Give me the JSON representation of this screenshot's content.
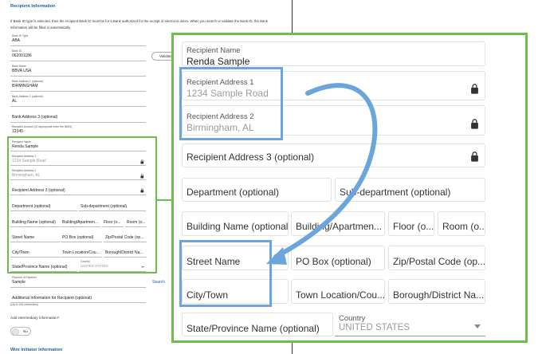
{
  "section_title": "Recipient Information",
  "note": "If Bank ID type is selected, then the recipient Bank ID must be for a Bank authorized for the receipt of electronic wires. When you search or validate the Bank ID, the Bank information will be filled in automatically.",
  "form": {
    "bank_id_type": {
      "label": "Bank ID Type",
      "value": "ABA"
    },
    "bank_id": {
      "label": "Bank ID",
      "value": "062001186"
    },
    "validate_label": "Validate",
    "bank_name": {
      "label": "Bank Name",
      "value": "BBVA USA"
    },
    "bank_address_1": {
      "label": "Bank Address 1 (optional)",
      "value": "BIRMINGHAM"
    },
    "bank_address_2": {
      "label": "Bank Address 2 (optional)",
      "value": "AL"
    },
    "bank_address_3": {
      "placeholder": "Bank Address 3 (optional)"
    },
    "recipient_account": {
      "label": "Recipient Account (ID appropriate enter the IBAN)",
      "value": "12345"
    },
    "recipient_name": {
      "label": "Recipient Name",
      "value": "Renda Sample"
    },
    "recipient_address_1": {
      "label": "Recipient Address 1",
      "value": "1234 Sample Road"
    },
    "recipient_address_2": {
      "label": "Recipient Address 2",
      "value": "Birmingham, AL"
    },
    "recipient_address_3": {
      "placeholder": "Recipient Address 3 (optional)"
    },
    "department": {
      "placeholder": "Department (optional)"
    },
    "sub_department": {
      "placeholder": "Sub-department (optional)"
    },
    "building_name": {
      "placeholder": "Building Name (optional)"
    },
    "building_number": {
      "placeholder": "Building/Apartmen...",
      "zoom_placeholder": "Building/Apartmen..."
    },
    "floor": {
      "placeholder": "Floor (o...",
      "zoom_placeholder": "Floor (o..."
    },
    "room": {
      "placeholder": "Room (o...",
      "zoom_placeholder": "Room (o..."
    },
    "street_name": {
      "placeholder": "Street Name"
    },
    "po_box": {
      "placeholder": "PO Box (optional)"
    },
    "zip": {
      "placeholder": "Zip/Postal Code (op..."
    },
    "city": {
      "placeholder": "City/Town"
    },
    "town_location": {
      "placeholder": "Town Location/Cou...",
      "zoom_placeholder": "Town Location/Cou..."
    },
    "borough": {
      "placeholder": "Borough/District Na..."
    },
    "state": {
      "placeholder": "State/Province Name (optional)"
    },
    "country": {
      "label": "Country",
      "value": "UNITED STATES"
    },
    "purpose": {
      "label": "Purpose of Payment",
      "value": "Sample"
    },
    "search_label": "Search",
    "additional_info": {
      "placeholder": "Additional Information for Recipient (optional)"
    },
    "char_hint": "(Up to 140 characters)",
    "intermediary_question": "Add intermediary information?",
    "toggle_label": "No",
    "next_section": "Wire Initiator Information"
  },
  "colors": {
    "highlight_green": "#6bc04b",
    "highlight_blue": "#6aa6dc",
    "link_blue": "#1f5ea8"
  }
}
